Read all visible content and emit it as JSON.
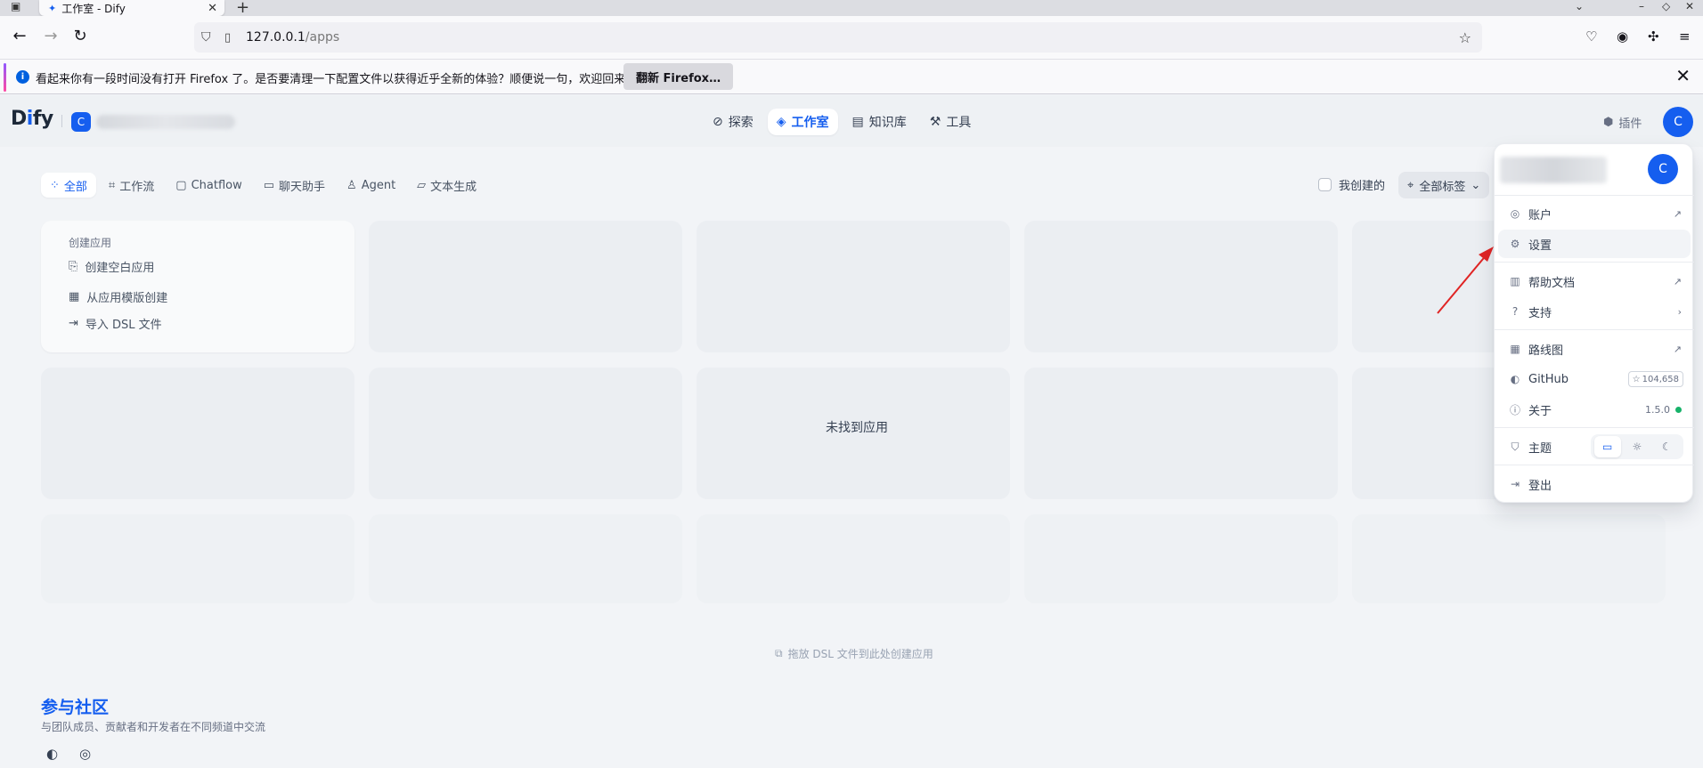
{
  "browser": {
    "tab_title": "工作室 - Dify",
    "tab_close": "✕",
    "new_tab": "+",
    "url_host": "127.0.0.1",
    "url_path": "/apps",
    "notice_text": "看起来你有一段时间没有打开 Firefox 了。是否要清理一下配置文件以获得近乎全新的体验？顺便说一句，欢迎回来！",
    "notice_button": "翻新 Firefox…",
    "notice_close": "✕"
  },
  "header": {
    "logo_prefix": "D",
    "logo_i": "i",
    "logo_suffix": "fy",
    "workspace_initial": "C",
    "nav": [
      {
        "label": "探索",
        "icon": "compass-icon"
      },
      {
        "label": "工作室",
        "icon": "robot-icon"
      },
      {
        "label": "知识库",
        "icon": "book-icon"
      },
      {
        "label": "工具",
        "icon": "hammer-icon"
      }
    ],
    "plugins_label": "插件",
    "user_initial": "C"
  },
  "filters": {
    "items": [
      "全部",
      "工作流",
      "Chatflow",
      "聊天助手",
      "Agent",
      "文本生成"
    ],
    "mine_label": "我创建的",
    "tags_label": "全部标签"
  },
  "create_card": {
    "title": "创建应用",
    "blank": "创建空白应用",
    "template": "从应用模版创建",
    "import_dsl": "导入 DSL 文件"
  },
  "empty_text": "未找到应用",
  "dropzone_text": "拖放 DSL 文件到此处创建应用",
  "community": {
    "title": "参与社区",
    "desc": "与团队成员、贡献者和开发者在不同频道中交流"
  },
  "menu": {
    "user_initial": "C",
    "account": "账户",
    "settings": "设置",
    "help_docs": "帮助文档",
    "support": "支持",
    "roadmap": "路线图",
    "github": "GitHub",
    "github_stars": "104,658",
    "about": "关于",
    "version": "1.5.0",
    "theme": "主题",
    "logout": "登出"
  },
  "colors": {
    "accent": "#155eef",
    "arrow": "#e02424",
    "status_ok": "#17b26a"
  }
}
